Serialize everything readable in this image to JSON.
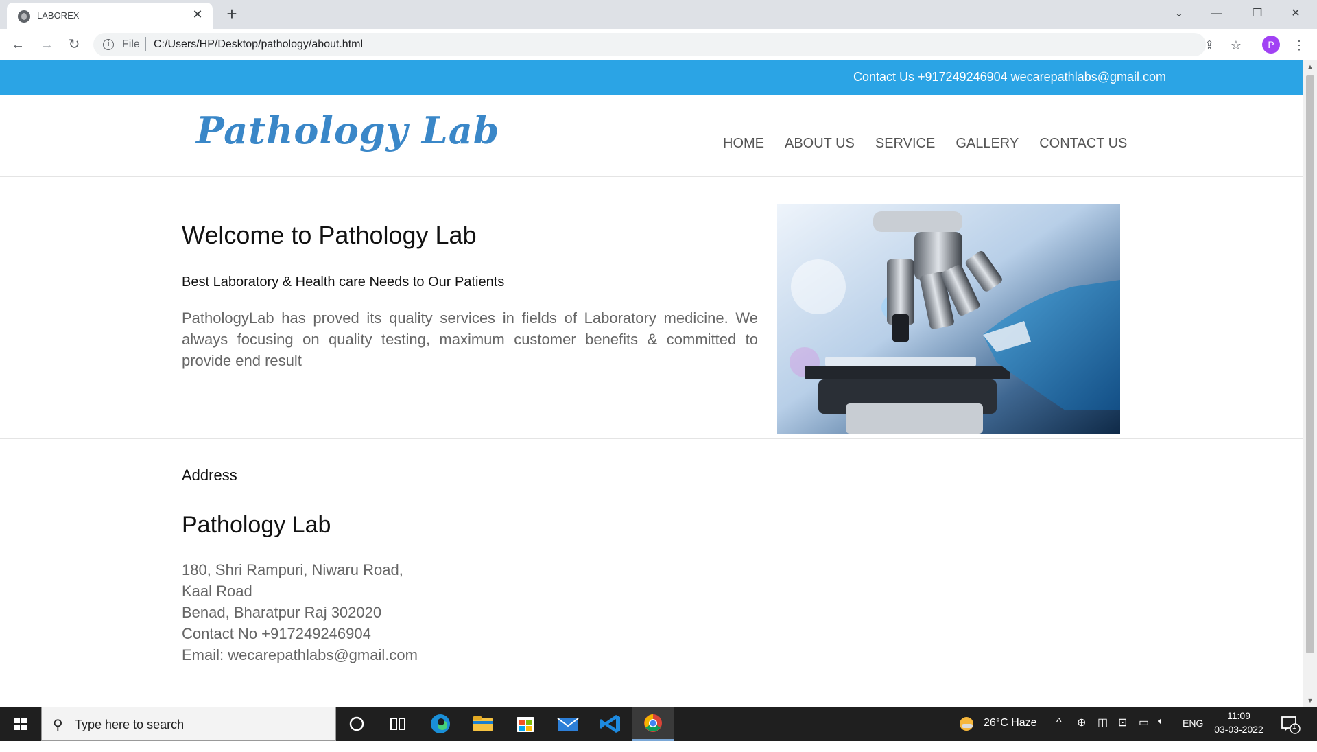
{
  "browser": {
    "tab_title": "LABOREX",
    "url_scheme": "File",
    "url": "C:/Users/HP/Desktop/pathology/about.html",
    "profile_initial": "P"
  },
  "topbar": {
    "contact": "Contact Us +917249246904 wecarepathlabs@gmail.com"
  },
  "header": {
    "logo": "Pathology Lab",
    "menu": [
      "HOME",
      "ABOUT US",
      "SERVICE",
      "GALLERY",
      "CONTACT US"
    ]
  },
  "welcome": {
    "title": "Welcome to Pathology Lab",
    "tagline": "Best Laboratory & Health care Needs to Our Patients",
    "description": "PathologyLab has proved its quality services in fields of Laboratory medicine. We always focusing on quality testing, maximum customer benefits & committed to provide end result"
  },
  "address": {
    "label": "Address",
    "name": "Pathology Lab",
    "line1": "180, Shri Rampuri, Niwaru Road,",
    "line2": "Kaal Road",
    "line3": "Benad, Bharatpur Raj 302020",
    "line4": "Contact No +917249246904",
    "line5": "Email: wecarepathlabs@gmail.com"
  },
  "taskbar": {
    "search_placeholder": "Type here to search",
    "weather": "26°C  Haze",
    "language": "ENG",
    "time": "11:09",
    "date": "03-03-2022",
    "notification_count": "1"
  },
  "colors": {
    "topbar": "#2ba4e5",
    "logo": "#3a87c8",
    "taskbar": "#1f1f1f"
  }
}
